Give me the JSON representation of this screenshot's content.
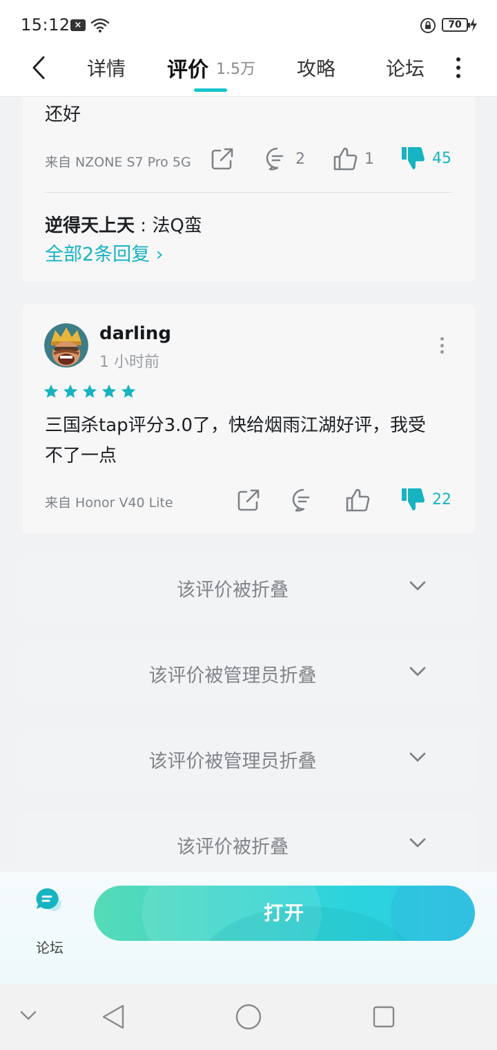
{
  "status_bar": {
    "time": "15:12",
    "battery": "70"
  },
  "top_nav": {
    "tabs": {
      "detail": "详情",
      "review": "评价",
      "review_count": "1.5万",
      "guide": "攻略",
      "forum": "论坛"
    }
  },
  "review1": {
    "text": "还好",
    "device": "来自 NZONE S7 Pro 5G",
    "comments": "2",
    "likes": "1",
    "dislikes": "45",
    "reply": {
      "name": "逆得天上天",
      "sep": " : ",
      "text": "法Q蛮"
    },
    "all_replies": "全部2条回复 ›"
  },
  "review2": {
    "username": "darling",
    "time_ago": "1 小时前",
    "rating": 5,
    "text_line1": "三国杀tap评分3.0了，快给烟雨江湖好评，我受",
    "text_line2": "不了一点",
    "device": "来自 Honor V40 Lite",
    "dislikes": "22"
  },
  "folded_reviews": [
    {
      "label": "该评价被折叠"
    },
    {
      "label": "该评价被管理员折叠"
    },
    {
      "label": "该评价被管理员折叠"
    },
    {
      "label": "该评价被折叠"
    }
  ],
  "bottom_bar": {
    "forum_label": "论坛",
    "open_label": "打开"
  },
  "colors": {
    "accent": "#17b3c0",
    "tab_underline": "#15c5ce"
  }
}
